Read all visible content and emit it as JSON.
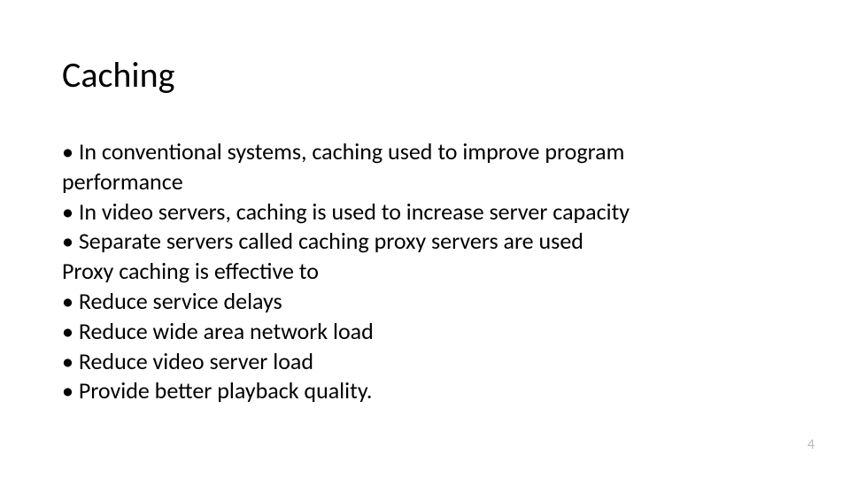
{
  "slide": {
    "title": "Caching",
    "lines": [
      "• In conventional systems, caching used to improve program",
      "   performance",
      "• In video servers, caching is used to increase server capacity",
      "• Separate servers called caching proxy servers are used",
      "Proxy caching is effective to",
      "• Reduce service delays",
      "• Reduce wide area network load",
      "• Reduce video server load",
      "• Provide better playback quality."
    ],
    "page_number": "4"
  }
}
